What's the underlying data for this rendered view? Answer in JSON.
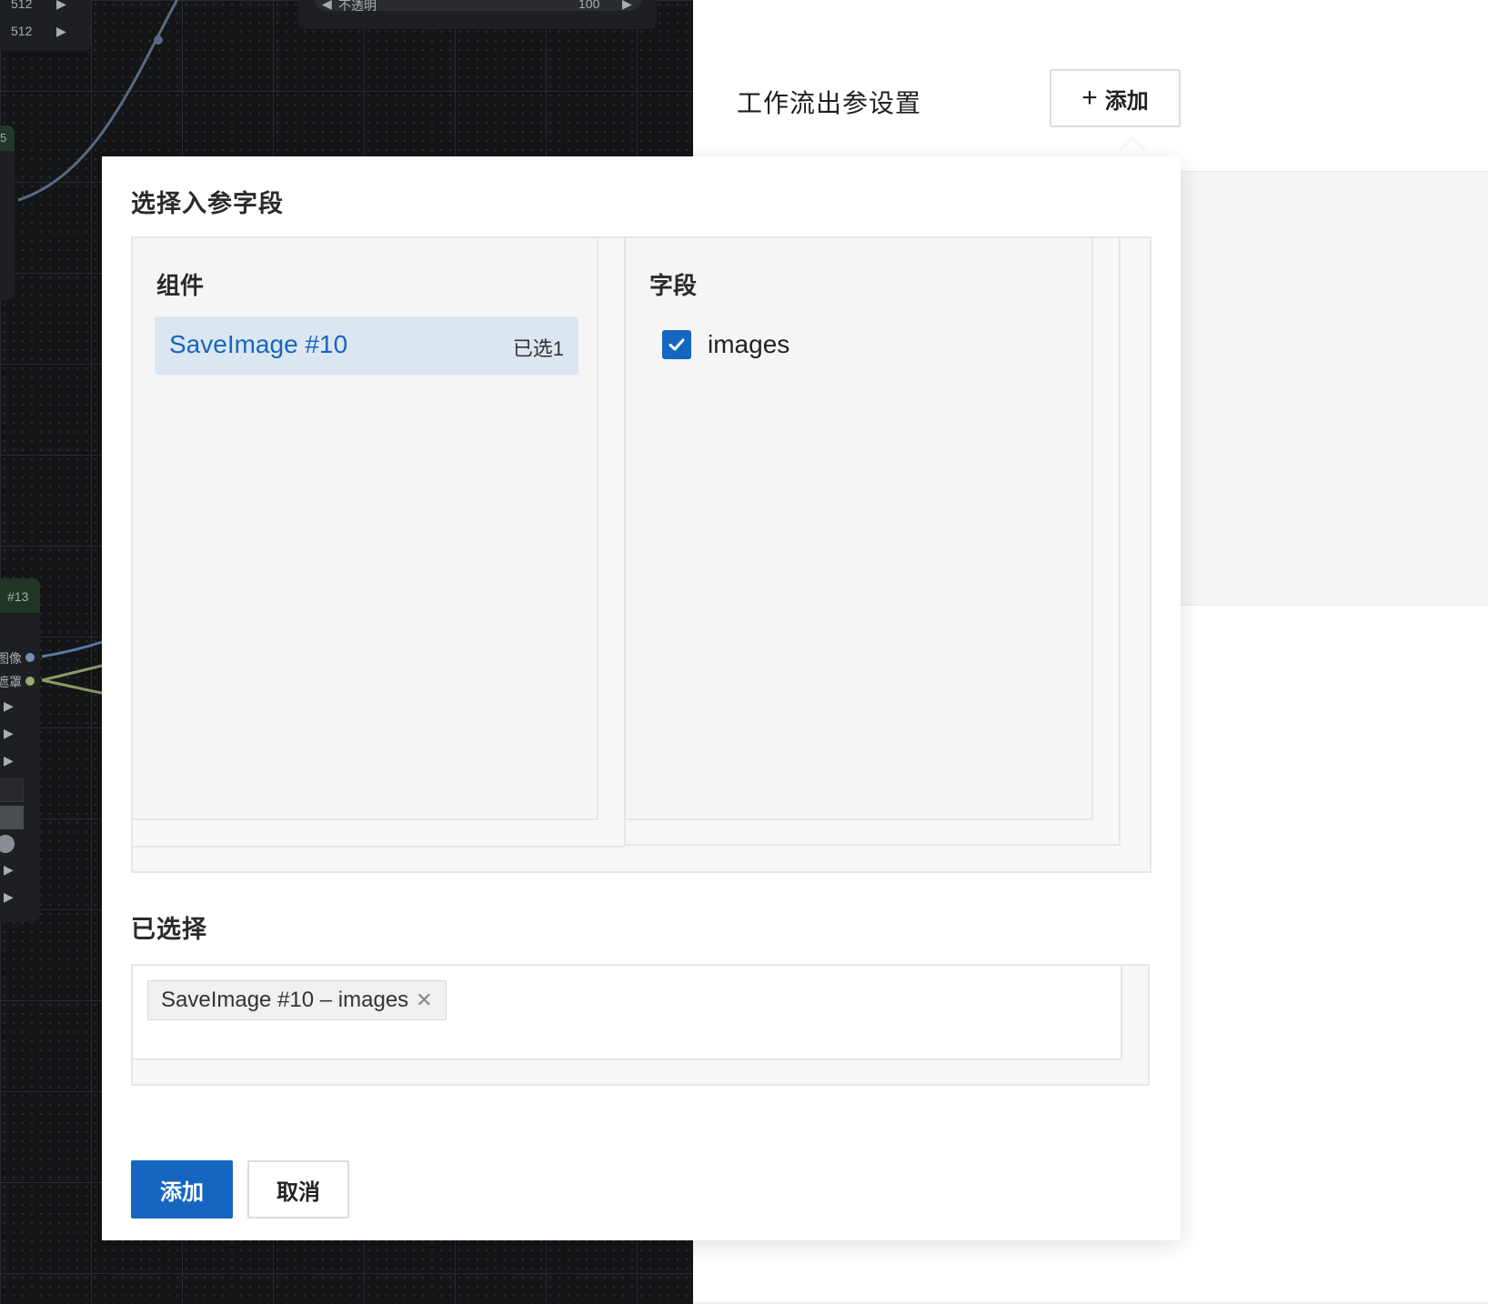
{
  "canvas": {
    "node_top": {
      "width_1": "512",
      "width_2": "512"
    },
    "node_opacity": {
      "label": "不透明",
      "value": "100"
    },
    "node_left_id": "5",
    "node13": {
      "id": "#13",
      "output_image": "图像",
      "output_mask": "遮罩"
    }
  },
  "right_panel": {
    "title": "工作流出参设置",
    "add_button": "添加"
  },
  "modal": {
    "title": "选择入参字段",
    "components_header": "组件",
    "fields_header": "字段",
    "components": [
      {
        "name": "SaveImage #10",
        "count_label": "已选1"
      }
    ],
    "fields": [
      {
        "name": "images",
        "checked": true
      }
    ],
    "selected_header": "已选择",
    "selected_tags": [
      {
        "label": "SaveImage #10 – images"
      }
    ],
    "confirm_button": "添加",
    "cancel_button": "取消"
  },
  "colors": {
    "primary": "#1566c0",
    "selected_item_bg": "#dce6f0",
    "canvas_bg": "#141517"
  }
}
